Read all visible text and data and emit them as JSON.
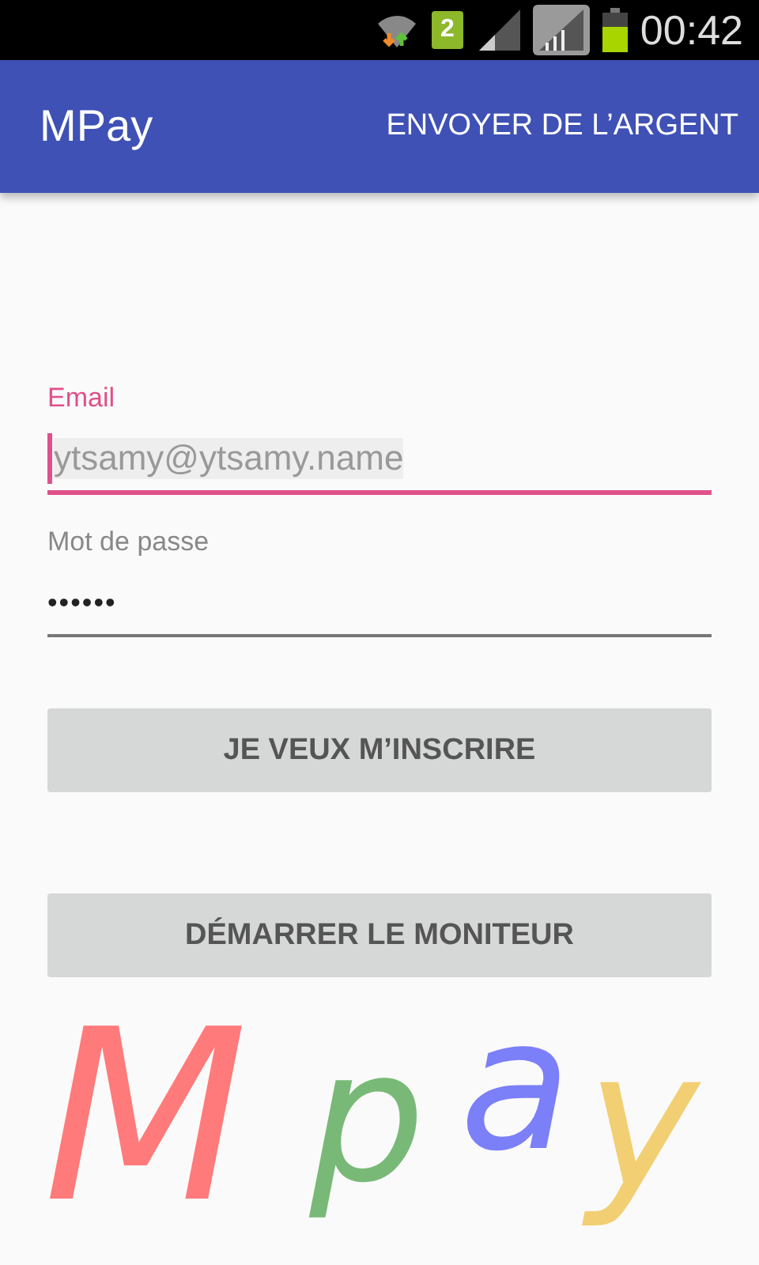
{
  "status_bar": {
    "sim_badge": "2",
    "time": "00:42"
  },
  "app_bar": {
    "title": "MPay",
    "action": "ENVOYER DE L’ARGENT"
  },
  "form": {
    "fields": [
      {
        "kind": "text",
        "label": "Email",
        "value": "ytsamy@ytsamy.name",
        "focused": true
      },
      {
        "kind": "password",
        "label": "Mot de passe",
        "value": "••••••",
        "focused": false
      }
    ],
    "buttons": [
      "JE VEUX M’INSCRIRE",
      "DÉMARRER LE MONITEUR"
    ]
  },
  "logo": [
    {
      "letter": "M",
      "color": "#ff7a7a"
    },
    {
      "letter": "p",
      "color": "#79b977"
    },
    {
      "letter": "a",
      "color": "#7b7ff8"
    },
    {
      "letter": "y",
      "color": "#f2cf73"
    }
  ]
}
